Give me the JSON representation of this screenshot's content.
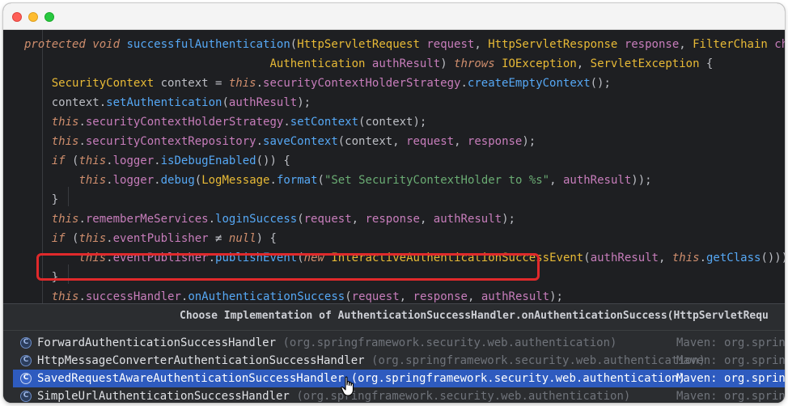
{
  "window": {
    "controls": [
      "close",
      "minimize",
      "zoom"
    ]
  },
  "editor": {
    "lines": [
      {
        "tokens": [
          {
            "t": "protected",
            "c": "kw"
          },
          {
            "t": " ",
            "c": "plain"
          },
          {
            "t": "void",
            "c": "kw"
          },
          {
            "t": " ",
            "c": "plain"
          },
          {
            "t": "successfulAuthentication",
            "c": "fn"
          },
          {
            "t": "(",
            "c": "plain"
          },
          {
            "t": "HttpServletRequest",
            "c": "ty"
          },
          {
            "t": " ",
            "c": "plain"
          },
          {
            "t": "request",
            "c": "param"
          },
          {
            "t": ", ",
            "c": "plain"
          },
          {
            "t": "HttpServletResponse",
            "c": "ty"
          },
          {
            "t": " ",
            "c": "plain"
          },
          {
            "t": "response",
            "c": "param"
          },
          {
            "t": ", ",
            "c": "plain"
          },
          {
            "t": "FilterChain",
            "c": "ty"
          },
          {
            "t": " ",
            "c": "plain"
          },
          {
            "t": "chain",
            "c": "param"
          },
          {
            "t": ",",
            "c": "plain"
          }
        ]
      },
      {
        "tokens": [
          {
            "t": "                                    ",
            "c": "plain"
          },
          {
            "t": "Authentication",
            "c": "ty"
          },
          {
            "t": " ",
            "c": "plain"
          },
          {
            "t": "authResult",
            "c": "param"
          },
          {
            "t": ") ",
            "c": "plain"
          },
          {
            "t": "throws",
            "c": "kw"
          },
          {
            "t": " ",
            "c": "plain"
          },
          {
            "t": "IOException",
            "c": "ty"
          },
          {
            "t": ", ",
            "c": "plain"
          },
          {
            "t": "ServletException",
            "c": "ty"
          },
          {
            "t": " {",
            "c": "plain"
          }
        ]
      },
      {
        "tokens": [
          {
            "t": "    ",
            "c": "plain"
          },
          {
            "t": "SecurityContext",
            "c": "ty"
          },
          {
            "t": " context = ",
            "c": "plain"
          },
          {
            "t": "this",
            "c": "kw"
          },
          {
            "t": ".",
            "c": "plain"
          },
          {
            "t": "securityContextHolderStrategy",
            "c": "param"
          },
          {
            "t": ".",
            "c": "plain"
          },
          {
            "t": "createEmptyContext",
            "c": "fn"
          },
          {
            "t": "();",
            "c": "plain"
          }
        ]
      },
      {
        "tokens": [
          {
            "t": "    context.",
            "c": "plain"
          },
          {
            "t": "setAuthentication",
            "c": "fn"
          },
          {
            "t": "(",
            "c": "plain"
          },
          {
            "t": "authResult",
            "c": "param"
          },
          {
            "t": ");",
            "c": "plain"
          }
        ]
      },
      {
        "tokens": [
          {
            "t": "    ",
            "c": "plain"
          },
          {
            "t": "this",
            "c": "kw"
          },
          {
            "t": ".",
            "c": "plain"
          },
          {
            "t": "securityContextHolderStrategy",
            "c": "param"
          },
          {
            "t": ".",
            "c": "plain"
          },
          {
            "t": "setContext",
            "c": "fn"
          },
          {
            "t": "(context);",
            "c": "plain"
          }
        ]
      },
      {
        "tokens": [
          {
            "t": "    ",
            "c": "plain"
          },
          {
            "t": "this",
            "c": "kw"
          },
          {
            "t": ".",
            "c": "plain"
          },
          {
            "t": "securityContextRepository",
            "c": "param"
          },
          {
            "t": ".",
            "c": "plain"
          },
          {
            "t": "saveContext",
            "c": "fn"
          },
          {
            "t": "(context, ",
            "c": "plain"
          },
          {
            "t": "request",
            "c": "param"
          },
          {
            "t": ", ",
            "c": "plain"
          },
          {
            "t": "response",
            "c": "param"
          },
          {
            "t": ");",
            "c": "plain"
          }
        ]
      },
      {
        "tokens": [
          {
            "t": "    ",
            "c": "plain"
          },
          {
            "t": "if",
            "c": "kw"
          },
          {
            "t": " (",
            "c": "plain"
          },
          {
            "t": "this",
            "c": "kw"
          },
          {
            "t": ".",
            "c": "plain"
          },
          {
            "t": "logger",
            "c": "param"
          },
          {
            "t": ".",
            "c": "plain"
          },
          {
            "t": "isDebugEnabled",
            "c": "fn"
          },
          {
            "t": "()) {",
            "c": "plain"
          }
        ]
      },
      {
        "tokens": [
          {
            "t": "        ",
            "c": "plain"
          },
          {
            "t": "this",
            "c": "kw"
          },
          {
            "t": ".",
            "c": "plain"
          },
          {
            "t": "logger",
            "c": "param"
          },
          {
            "t": ".",
            "c": "plain"
          },
          {
            "t": "debug",
            "c": "fn"
          },
          {
            "t": "(",
            "c": "plain"
          },
          {
            "t": "LogMessage",
            "c": "ty"
          },
          {
            "t": ".",
            "c": "plain"
          },
          {
            "t": "format",
            "c": "fn"
          },
          {
            "t": "(",
            "c": "plain"
          },
          {
            "t": "\"Set SecurityContextHolder to %s\"",
            "c": "str"
          },
          {
            "t": ", ",
            "c": "plain"
          },
          {
            "t": "authResult",
            "c": "param"
          },
          {
            "t": "));",
            "c": "plain"
          }
        ]
      },
      {
        "tokens": [
          {
            "t": "    }",
            "c": "plain"
          }
        ]
      },
      {
        "tokens": [
          {
            "t": "    ",
            "c": "plain"
          },
          {
            "t": "this",
            "c": "kw"
          },
          {
            "t": ".",
            "c": "plain"
          },
          {
            "t": "rememberMeServices",
            "c": "param"
          },
          {
            "t": ".",
            "c": "plain"
          },
          {
            "t": "loginSuccess",
            "c": "fn"
          },
          {
            "t": "(",
            "c": "plain"
          },
          {
            "t": "request",
            "c": "param"
          },
          {
            "t": ", ",
            "c": "plain"
          },
          {
            "t": "response",
            "c": "param"
          },
          {
            "t": ", ",
            "c": "plain"
          },
          {
            "t": "authResult",
            "c": "param"
          },
          {
            "t": ");",
            "c": "plain"
          }
        ]
      },
      {
        "tokens": [
          {
            "t": "    ",
            "c": "plain"
          },
          {
            "t": "if",
            "c": "kw"
          },
          {
            "t": " (",
            "c": "plain"
          },
          {
            "t": "this",
            "c": "kw"
          },
          {
            "t": ".",
            "c": "plain"
          },
          {
            "t": "eventPublisher",
            "c": "param"
          },
          {
            "t": " ≠ ",
            "c": "plain"
          },
          {
            "t": "null",
            "c": "kw"
          },
          {
            "t": ") {",
            "c": "plain"
          }
        ]
      },
      {
        "tokens": [
          {
            "t": "        ",
            "c": "plain"
          },
          {
            "t": "this",
            "c": "kw"
          },
          {
            "t": ".",
            "c": "plain"
          },
          {
            "t": "eventPublisher",
            "c": "param"
          },
          {
            "t": ".",
            "c": "plain"
          },
          {
            "t": "publishEvent",
            "c": "fn"
          },
          {
            "t": "(",
            "c": "plain"
          },
          {
            "t": "new",
            "c": "kw"
          },
          {
            "t": " ",
            "c": "plain"
          },
          {
            "t": "InteractiveAuthenticationSuccessEvent",
            "c": "ty"
          },
          {
            "t": "(",
            "c": "plain"
          },
          {
            "t": "authResult",
            "c": "param"
          },
          {
            "t": ", ",
            "c": "plain"
          },
          {
            "t": "this",
            "c": "kw"
          },
          {
            "t": ".",
            "c": "plain"
          },
          {
            "t": "getClass",
            "c": "fn"
          },
          {
            "t": "()));",
            "c": "plain"
          }
        ]
      },
      {
        "tokens": [
          {
            "t": "    }",
            "c": "plain"
          }
        ]
      },
      {
        "tokens": [
          {
            "t": "    ",
            "c": "plain"
          },
          {
            "t": "this",
            "c": "kw"
          },
          {
            "t": ".",
            "c": "plain"
          },
          {
            "t": "successHandler",
            "c": "param"
          },
          {
            "t": ".",
            "c": "plain"
          },
          {
            "t": "onAuthenticationSuccess",
            "c": "fn"
          },
          {
            "t": "(",
            "c": "plain"
          },
          {
            "t": "request",
            "c": "param"
          },
          {
            "t": ", ",
            "c": "plain"
          },
          {
            "t": "response",
            "c": "param"
          },
          {
            "t": ", ",
            "c": "plain"
          },
          {
            "t": "authResult",
            "c": "param"
          },
          {
            "t": ");",
            "c": "plain"
          }
        ]
      }
    ]
  },
  "popup": {
    "title": "Choose Implementation of AuthenticationSuccessHandler.onAuthenticationSuccess(HttpServletRequ",
    "items": [
      {
        "name": "ForwardAuthenticationSuccessHandler",
        "pkg": "(org.springframework.security.web.authentication)",
        "source": "Maven: org.spring",
        "icon": "C",
        "selected": false
      },
      {
        "name": "HttpMessageConverterAuthenticationSuccessHandler",
        "pkg": "(org.springframework.security.web.authentication)",
        "source": "Maven: org.spring",
        "icon": "C",
        "selected": false
      },
      {
        "name": "SavedRequestAwareAuthenticationSuccessHandler",
        "pkg": "(org.springframework.security.web.authentication)",
        "source": "Maven: org.spring",
        "icon": "C",
        "selected": true
      },
      {
        "name": "SimpleUrlAuthenticationSuccessHandler",
        "pkg": "(org.springframework.security.web.authentication)",
        "source": "Maven: org.spring",
        "icon": "C",
        "selected": false
      }
    ]
  },
  "colors": {
    "editor_bg": "#1e1f22",
    "popup_bg": "#2b2d30",
    "selection": "#2e5bbf",
    "highlight_border": "#e0292b",
    "keyword": "#cf8e6d",
    "function": "#56a8f5",
    "type": "#e8ba36",
    "field": "#c77dbb",
    "string": "#6aab73"
  }
}
